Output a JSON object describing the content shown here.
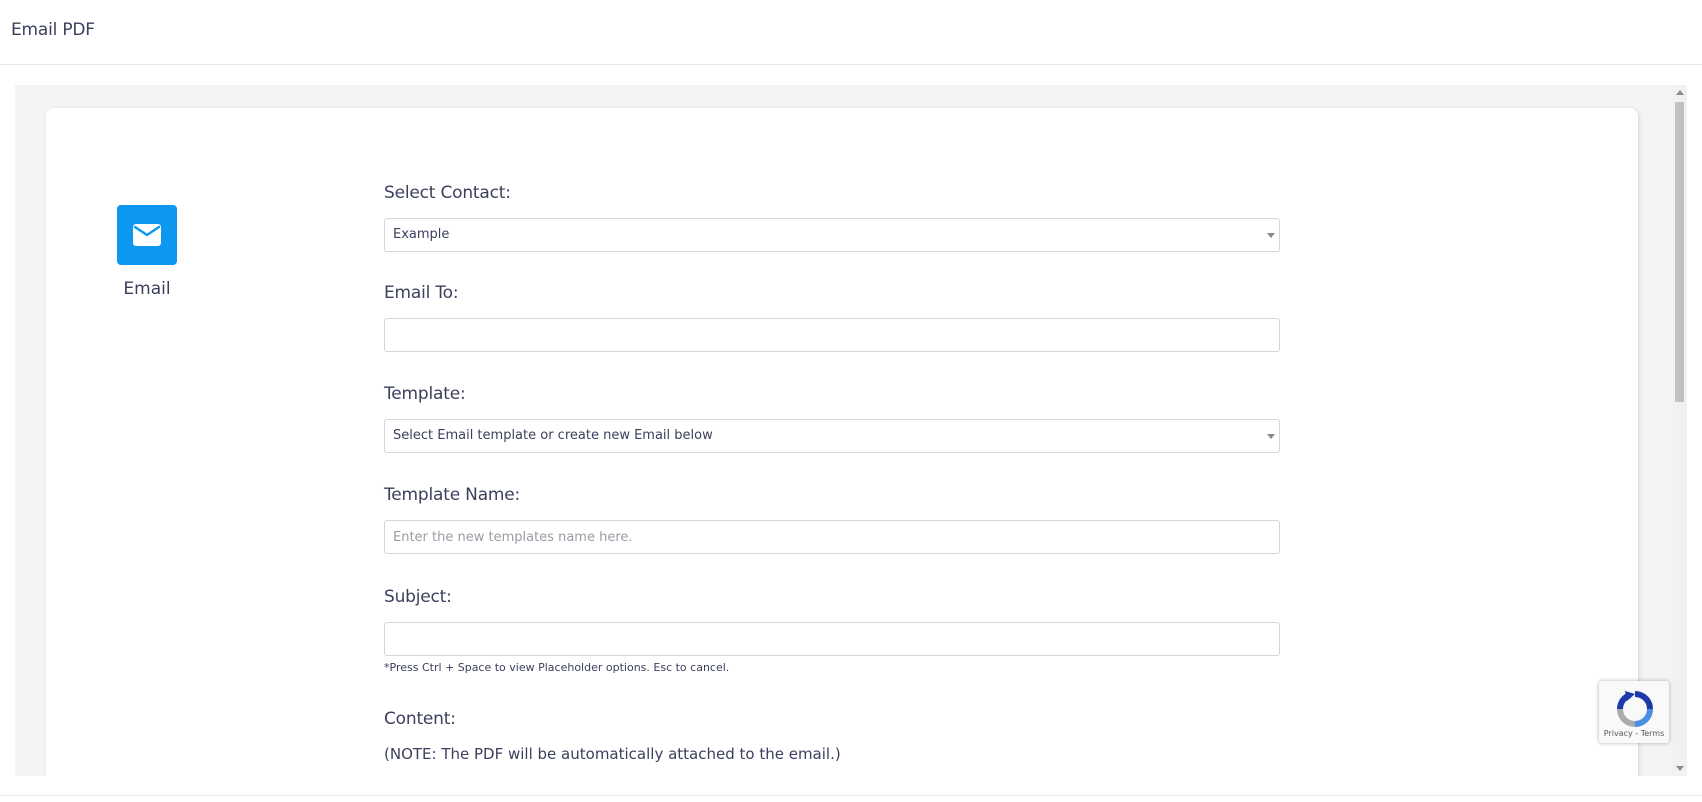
{
  "window": {
    "title": "Email PDF"
  },
  "sidebar": {
    "icon": "envelope-icon",
    "label": "Email",
    "accent": "#0c97f1"
  },
  "form": {
    "select_contact": {
      "label": "Select Contact:",
      "value": "Example"
    },
    "email_to": {
      "label": "Email To:",
      "value": ""
    },
    "template": {
      "label": "Template:",
      "value": "Select Email template or create new Email below"
    },
    "template_name": {
      "label": "Template Name:",
      "placeholder": "Enter the new templates name here."
    },
    "subject": {
      "label": "Subject:",
      "value": "",
      "hint": "*Press Ctrl + Space to view Placeholder options. Esc to cancel."
    },
    "content": {
      "label": "Content:",
      "note": "(NOTE: The PDF will be automatically attached to the email.)"
    }
  },
  "recaptcha": {
    "links": "Privacy - Terms"
  }
}
